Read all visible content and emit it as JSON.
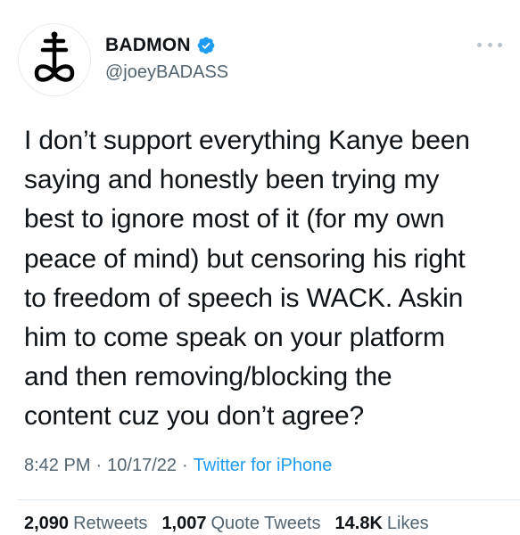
{
  "author": {
    "display_name": "BADMON",
    "handle": "@joeyBADASS",
    "verified": true,
    "verified_icon": "verified-badge-icon",
    "avatar_icon": "leviathan-cross-icon"
  },
  "more_icon": "more-options-icon",
  "tweet": {
    "lines": [
      "I don’t support everything Kanye been",
      "saying and honestly been trying my",
      "best to ignore most of it (for my own",
      "peace of mind) but censoring his right",
      "to freedom of speech is WACK. Askin",
      "him to come speak on your platform",
      "and then removing/blocking the",
      "content cuz you don’t agree?"
    ]
  },
  "meta": {
    "time": "8:42 PM",
    "separator": "·",
    "date": "10/17/22",
    "source": "Twitter for iPhone"
  },
  "stats": {
    "retweets_count": "2,090",
    "retweets_label": "Retweets",
    "quotes_count": "1,007",
    "quotes_label": "Quote Tweets",
    "likes_count": "14.8K",
    "likes_label": "Likes"
  },
  "colors": {
    "text": "#0f1419",
    "secondary": "#536471",
    "accent": "#1d9bf0",
    "divider": "#e1e8ed"
  }
}
